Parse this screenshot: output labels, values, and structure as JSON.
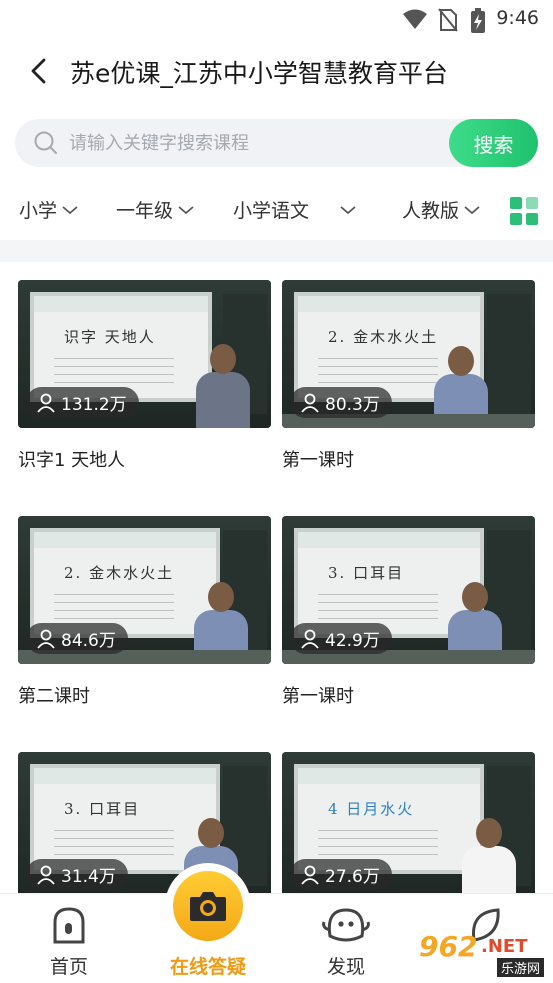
{
  "status_bar": {
    "time": "9:46"
  },
  "header": {
    "title": "苏e优课_江苏中小学智慧教育平台"
  },
  "search": {
    "placeholder": "请输入关键字搜索课程",
    "button_label": "搜索"
  },
  "filters": [
    {
      "label": "小学"
    },
    {
      "label": "一年级"
    },
    {
      "label": "小学语文"
    },
    {
      "label": "人教版"
    }
  ],
  "videos": [
    {
      "title": "识字1 天地人",
      "views": "131.2万",
      "slide_title": "识字   天地人"
    },
    {
      "title": "第一课时",
      "views": "80.3万",
      "slide_title": "2. 金木水火土"
    },
    {
      "title": "第二课时",
      "views": "84.6万",
      "slide_title": "2. 金木水火土"
    },
    {
      "title": "第一课时",
      "views": "42.9万",
      "slide_title": "3. 口耳目"
    },
    {
      "title": "",
      "views": "31.4万",
      "slide_title": "3. 口耳目"
    },
    {
      "title": "",
      "views": "27.6万",
      "slide_title": "4 日月水火"
    }
  ],
  "bottom_nav": [
    {
      "label": "首页",
      "icon": "home-icon"
    },
    {
      "label": "在线答疑",
      "icon": "camera-icon"
    },
    {
      "label": "发现",
      "icon": "ghost-icon"
    },
    {
      "label": "",
      "icon": "leaf-icon"
    }
  ],
  "colors": {
    "accent_green": "#1fc26e",
    "nav_active": "#f09a13",
    "camera_yellow": "#f4a917"
  },
  "watermark": {
    "number": "962",
    "domain": ".NET",
    "subtitle": "乐游网"
  }
}
